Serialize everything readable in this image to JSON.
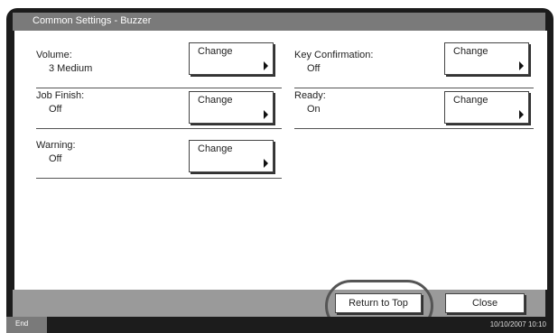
{
  "title": "Common Settings - Buzzer",
  "settings": {
    "volume": {
      "label": "Volume:",
      "value": "3 Medium",
      "button": "Change"
    },
    "job_finish": {
      "label": "Job Finish:",
      "value": "Off",
      "button": "Change"
    },
    "warning": {
      "label": "Warning:",
      "value": "Off",
      "button": "Change"
    },
    "key_confirmation": {
      "label": "Key Confirmation:",
      "value": "Off",
      "button": "Change"
    },
    "ready": {
      "label": "Ready:",
      "value": "On",
      "button": "Change"
    }
  },
  "footer": {
    "return_label": "Return to Top",
    "close_label": "Close"
  },
  "status": {
    "end_label": "End",
    "datetime": "10/10/2007   10:10"
  }
}
